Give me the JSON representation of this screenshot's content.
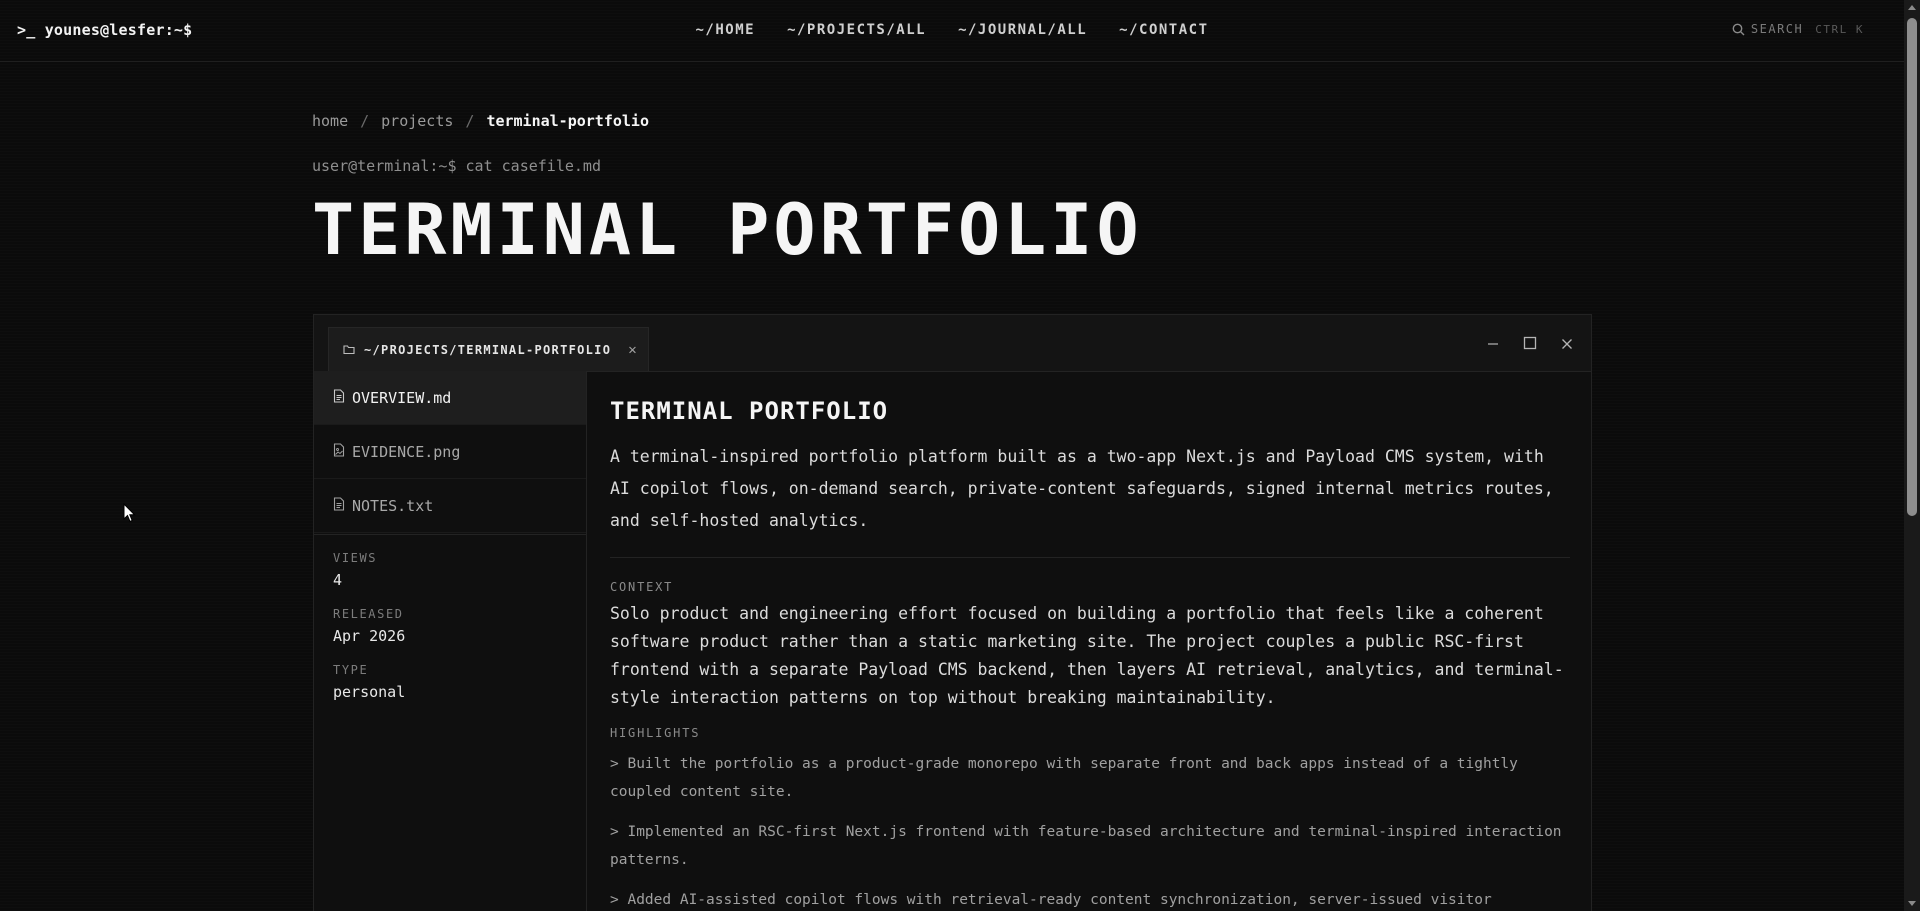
{
  "header": {
    "brand": ">_ younes@lesfer:~$",
    "nav": [
      "~/HOME",
      "~/PROJECTS/ALL",
      "~/JOURNAL/ALL",
      "~/CONTACT"
    ],
    "search_label": "SEARCH",
    "search_shortcut": "CTRL K"
  },
  "breadcrumb": {
    "items": [
      "home",
      "projects",
      "terminal-portfolio"
    ],
    "separator": "/"
  },
  "command": "user@terminal:~$ cat casefile.md",
  "page_title": "TERMINAL PORTFOLIO",
  "window": {
    "tab_label": "~/PROJECTS/TERMINAL-PORTFOLIO",
    "files": [
      {
        "name": "OVERVIEW.md",
        "icon": "file-text-icon",
        "active": true
      },
      {
        "name": "EVIDENCE.png",
        "icon": "file-image-icon",
        "active": false
      },
      {
        "name": "NOTES.txt",
        "icon": "file-text-icon",
        "active": false
      }
    ],
    "meta": [
      {
        "label": "VIEWS",
        "value": "4"
      },
      {
        "label": "RELEASED",
        "value": "Apr 2026"
      },
      {
        "label": "TYPE",
        "value": "personal"
      }
    ]
  },
  "content": {
    "title": "TERMINAL PORTFOLIO",
    "summary": "A terminal-inspired portfolio platform built as a two-app Next.js and Payload CMS system, with AI copilot flows, on-demand search, private-content safeguards, signed internal metrics routes, and self-hosted analytics.",
    "context_label": "CONTEXT",
    "context": "Solo product and engineering effort focused on building a portfolio that feels like a coherent software product rather than a static marketing site. The project couples a public RSC-first frontend with a separate Payload CMS backend, then layers AI retrieval, analytics, and terminal-style interaction patterns on top without breaking maintainability.",
    "highlights_label": "HIGHLIGHTS",
    "highlights": [
      "> Built the portfolio as a product-grade monorepo with separate front and back apps instead of a tightly coupled content site.",
      "> Implemented an RSC-first Next.js frontend with feature-based architecture and terminal-inspired interaction patterns.",
      "> Added AI-assisted copilot flows with retrieval-ready content synchronization, server-issued visitor identity"
    ]
  },
  "colors": {
    "background": "#0b0b0b",
    "panel": "#0f0f0f",
    "accent_text": "#f5f5f5",
    "muted_text": "#8f8f8f"
  }
}
